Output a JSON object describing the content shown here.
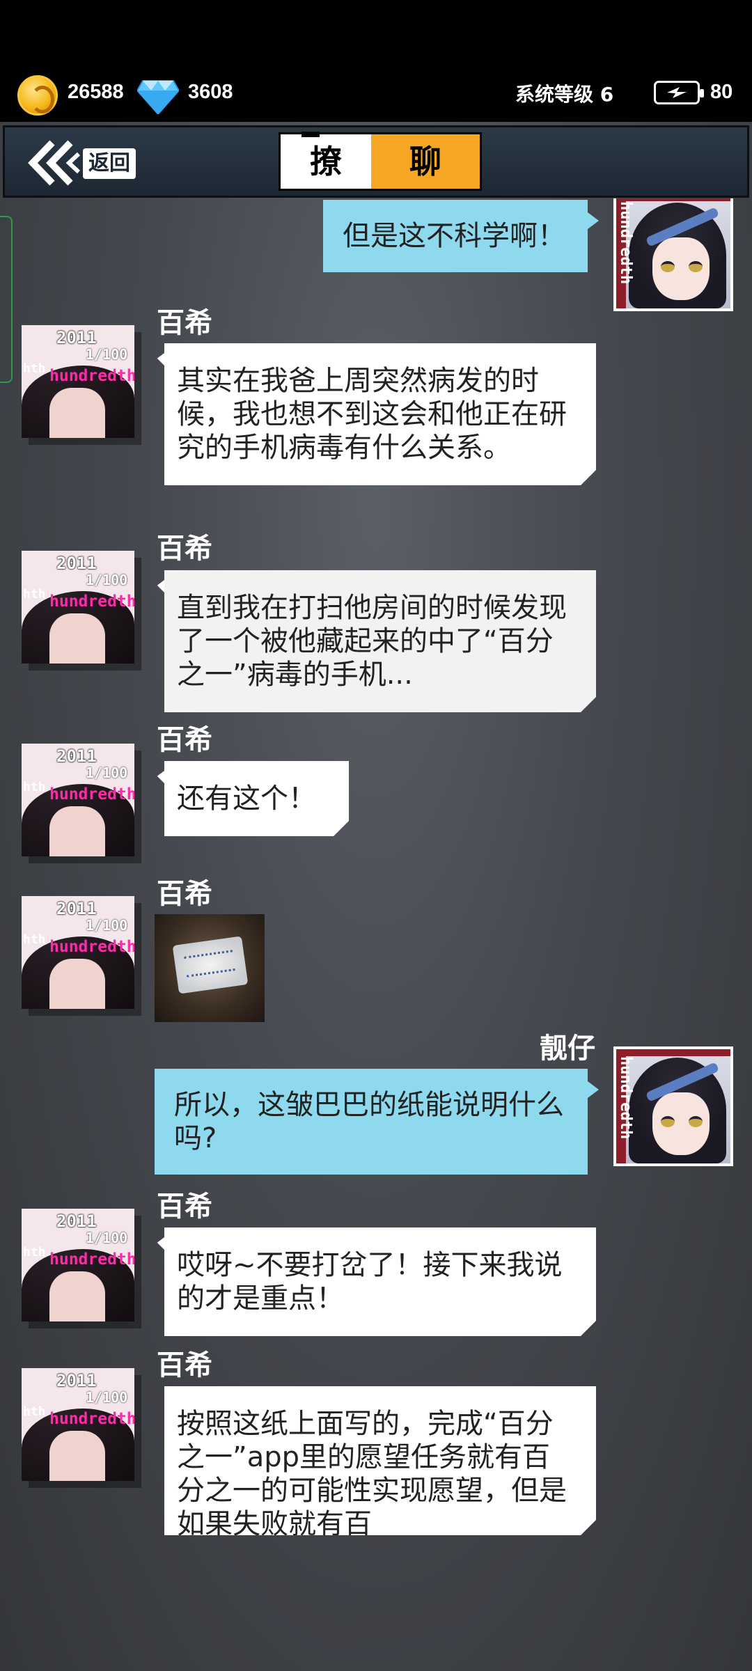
{
  "status": {
    "coins": "26588",
    "gems": "3608",
    "system_level": "系统等级 6",
    "energy": "80"
  },
  "nav": {
    "back_label": "返回",
    "title_left": "撩",
    "title_right": "聊"
  },
  "avatar_text": {
    "left_top": "2011",
    "left_mid": "1/100",
    "left_pink": "hundredth",
    "left_side": "hth",
    "right_side": "hundredth"
  },
  "messages": [
    {
      "side": "right",
      "name": "",
      "text": "但是这不科学啊！"
    },
    {
      "side": "left",
      "name": "百希",
      "text": "其实在我爸上周突然病发的时候，我也想不到这会和他正在研究的手机病毒有什么关系。"
    },
    {
      "side": "left",
      "name": "百希",
      "text": "直到我在打扫他房间的时候发现了一个被他藏起来的中了“百分之一”病毒的手机..."
    },
    {
      "side": "left",
      "name": "百希",
      "text": "还有这个！"
    },
    {
      "side": "left",
      "name": "百希",
      "text": ""
    },
    {
      "side": "right",
      "name": "靓仔",
      "text": "所以，这皱巴巴的纸能说明什么吗?"
    },
    {
      "side": "left",
      "name": "百希",
      "text": "哎呀~不要打岔了！接下来我说的才是重点！"
    },
    {
      "side": "left",
      "name": "百希",
      "text": "按照这纸上面写的，完成“百分之一”app里的愿望任务就有百分之一的可能性实现愿望，但是如果失败就有百"
    }
  ]
}
